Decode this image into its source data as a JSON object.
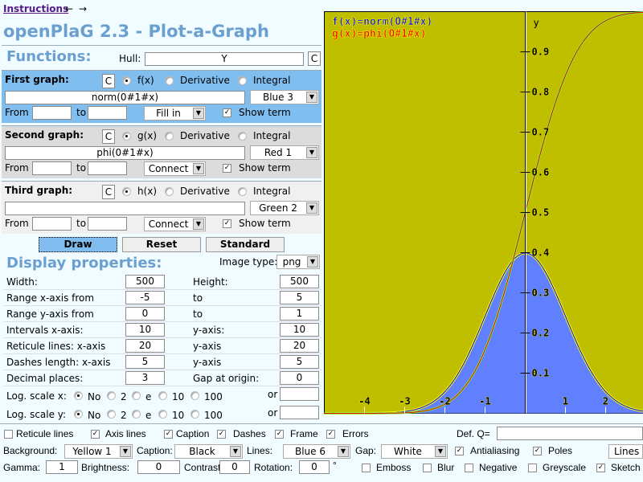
{
  "nav": {
    "instructions": "Instructions",
    "back": "←",
    "forward": "→"
  },
  "title": "openPlaG 2.3 - Plot-a-Graph",
  "functions": {
    "heading": "Functions:",
    "hull_label": "Hull:",
    "hull_value": "Y",
    "hull_clear": "C"
  },
  "graphs": [
    {
      "title": "First graph:",
      "clear": "C",
      "options": [
        "f(x)",
        "Derivative",
        "Integral"
      ],
      "selected": 0,
      "term": "norm(0#1#x)",
      "color": "Blue 3",
      "from_label": "From",
      "from": "",
      "to_label": "to",
      "to": "",
      "mode": "Fill in",
      "show_term_label": "Show term",
      "show_term": true,
      "bg": "#80bef0"
    },
    {
      "title": "Second graph:",
      "clear": "C",
      "options": [
        "g(x)",
        "Derivative",
        "Integral"
      ],
      "selected": 0,
      "term": "phi(0#1#x)",
      "color": "Red 1",
      "from_label": "From",
      "from": "",
      "to_label": "to",
      "to": "",
      "mode": "Connect",
      "show_term_label": "Show term",
      "show_term": true,
      "bg": "#dcdcdc"
    },
    {
      "title": "Third graph:",
      "clear": "C",
      "options": [
        "h(x)",
        "Derivative",
        "Integral"
      ],
      "selected": 0,
      "term": "",
      "color": "Green 2",
      "from_label": "From",
      "from": "",
      "to_label": "to",
      "to": "",
      "mode": "Connect",
      "show_term_label": "Show term",
      "show_term": true,
      "bg": "#f0f0f0"
    }
  ],
  "buttons": {
    "draw": "Draw",
    "reset": "Reset",
    "standard": "Standard"
  },
  "display": {
    "heading": "Display properties:",
    "image_type_label": "Image type:",
    "image_type": "png",
    "rows": [
      {
        "label": "Width:",
        "value": "500",
        "label2": "Height:",
        "value2": "500"
      },
      {
        "label": "Range x-axis from",
        "value": "-5",
        "label2": "to",
        "value2": "5"
      },
      {
        "label": "Range y-axis from",
        "value": "0",
        "label2": "to",
        "value2": "1"
      },
      {
        "label": "Intervals x-axis:",
        "value": "10",
        "label2": "y-axis:",
        "value2": "10"
      },
      {
        "label": "Reticule lines: x-axis",
        "value": "20",
        "label2": "y-axis",
        "value2": "20"
      },
      {
        "label": "Dashes length: x-axis",
        "value": "5",
        "label2": "y-axis",
        "value2": "5"
      },
      {
        "label": "Decimal places:",
        "value": "3",
        "label2": "Gap at origin:",
        "value2": "0"
      }
    ],
    "log": [
      {
        "label": "Log. scale x:",
        "options": [
          "No",
          "2",
          "e",
          "10",
          "100"
        ],
        "selected": 0,
        "or_label": "or",
        "or_value": ""
      },
      {
        "label": "Log. scale y:",
        "options": [
          "No",
          "2",
          "e",
          "10",
          "100"
        ],
        "selected": 0,
        "or_label": "or",
        "or_value": ""
      }
    ]
  },
  "bottom": {
    "checks1": [
      {
        "label": "Reticule lines",
        "checked": false
      },
      {
        "label": "Axis lines",
        "checked": true
      },
      {
        "label": "Caption",
        "checked": true
      },
      {
        "label": "Dashes",
        "checked": true
      },
      {
        "label": "Frame",
        "checked": true
      },
      {
        "label": "Errors",
        "checked": true
      }
    ],
    "defq_label": "Def. Q=",
    "defq_value": "",
    "background_label": "Background:",
    "background": "Yellow 1",
    "caption_label": "Caption:",
    "caption": "Black",
    "lines_label": "Lines:",
    "lines": "Blue 6",
    "gap_label": "Gap:",
    "gap": "White",
    "antialiasing_label": "Antialiasing",
    "antialiasing": true,
    "poles_label": "Poles",
    "poles": true,
    "draw_mode": "Lines",
    "gamma_label": "Gamma:",
    "gamma": "1",
    "brightness_label": "Brightness:",
    "brightness": "0",
    "contrast_label": "Contrast:",
    "contrast": "0",
    "rotation_label": "Rotation:",
    "rotation": "0",
    "degree": "°",
    "checks2": [
      {
        "label": "Emboss",
        "checked": false
      },
      {
        "label": "Blur",
        "checked": false
      },
      {
        "label": "Negative",
        "checked": false
      },
      {
        "label": "Greyscale",
        "checked": false
      },
      {
        "label": "Sketch",
        "checked": true
      }
    ]
  },
  "plot": {
    "xlim": [
      -5,
      5
    ],
    "ylim": [
      0,
      1
    ],
    "background": "#bfbf00",
    "fill_color": "#6080ff",
    "line_color_f": "#0000ff",
    "line_color_g": "#e00000",
    "caption_f": "f(x)=norm(0#1#x)",
    "caption_g": "g(x)=phi(0#1#x)",
    "y_axis_label": "y",
    "x_ticks": [
      "-4",
      "-3",
      "-2",
      "-1",
      "1",
      "2"
    ],
    "y_ticks": [
      "0.1",
      "0.2",
      "0.3",
      "0.4",
      "0.5",
      "0.6",
      "0.7",
      "0.8",
      "0.9"
    ]
  }
}
